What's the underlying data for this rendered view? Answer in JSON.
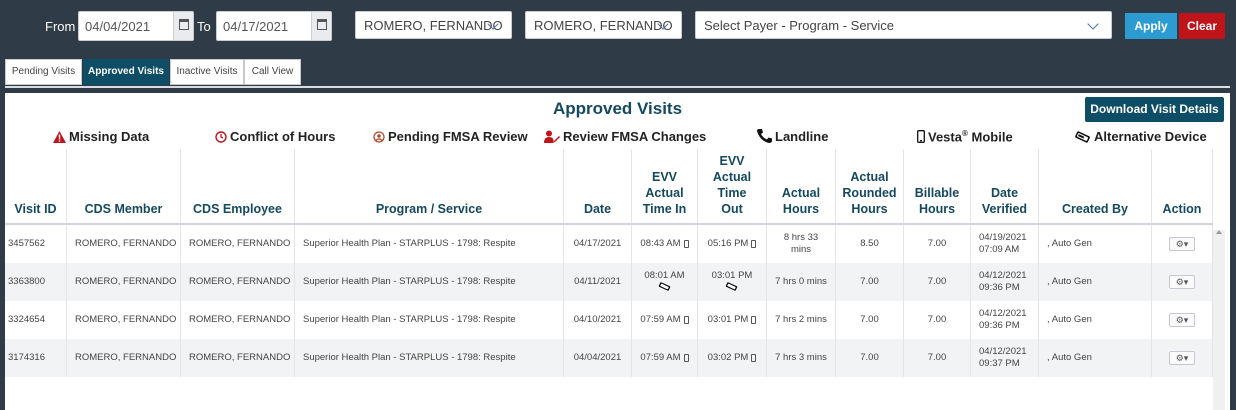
{
  "filter": {
    "from_label": "From",
    "from_date": "04/04/2021",
    "to_label": "To",
    "to_date": "04/17/2021",
    "member_select": "ROMERO, FERNANDO",
    "employee_select": "ROMERO, FERNANDO",
    "payer_placeholder": "Select Payer - Program - Service",
    "apply_label": "Apply",
    "clear_label": "Clear"
  },
  "tabs": [
    {
      "label": "Pending Visits",
      "active": false
    },
    {
      "label": "Approved Visits",
      "active": true
    },
    {
      "label": "Inactive Visits",
      "active": false
    },
    {
      "label": "Call View",
      "active": false
    }
  ],
  "panel": {
    "title": "Approved Visits",
    "download_label": "Download Visit Details"
  },
  "legend": {
    "missing_data": "Missing Data",
    "conflict_hours": "Conflict of Hours",
    "pending_fmsa": "Pending FMSA Review",
    "review_fmsa": "Review FMSA Changes",
    "landline": "Landline",
    "vesta_mobile": "Vesta",
    "vesta_reg": "®",
    "vesta_mobile_suffix": "Mobile",
    "alt_device": "Alternative Device"
  },
  "table": {
    "headers": {
      "visit_id": "Visit ID",
      "cds_member": "CDS Member",
      "cds_employee": "CDS Employee",
      "program_service": "Program / Service",
      "date": "Date",
      "evv_in_1": "EVV",
      "evv_in_2": "Actual",
      "evv_in_3": "Time In",
      "evv_out_1": "EVV",
      "evv_out_2": "Actual",
      "evv_out_3": "Time",
      "evv_out_4": "Out",
      "actual_hours_1": "Actual",
      "actual_hours_2": "Hours",
      "rounded_1": "Actual",
      "rounded_2": "Rounded",
      "rounded_3": "Hours",
      "billable_1": "Billable",
      "billable_2": "Hours",
      "verified_1": "Date",
      "verified_2": "Verified",
      "created_by": "Created By",
      "action": "Action"
    },
    "rows": [
      {
        "visit_id": "3457562",
        "member": "ROMERO, FERNANDO",
        "employee": "ROMERO, FERNANDO",
        "program": "Superior Health Plan - STARPLUS - 1798: Respite",
        "date": "04/17/2021",
        "time_in": "08:43 AM",
        "time_out": "05:16 PM",
        "actual_hours_1": "8 hrs 33",
        "actual_hours_2": "mins",
        "rounded": "8.50",
        "billable": "7.00",
        "verified_date": "04/19/2021",
        "verified_time": "07:09 AM",
        "created_by": ", Auto Gen"
      },
      {
        "visit_id": "3363800",
        "member": "ROMERO, FERNANDO",
        "employee": "ROMERO, FERNANDO",
        "program": "Superior Health Plan - STARPLUS - 1798: Respite",
        "date": "04/11/2021",
        "time_in": "08:01 AM",
        "time_out": "03:01 PM",
        "actual_hours_1": "7 hrs 0 mins",
        "actual_hours_2": "",
        "rounded": "7.00",
        "billable": "7.00",
        "verified_date": "04/12/2021",
        "verified_time": "09:36 PM",
        "created_by": ", Auto Gen"
      },
      {
        "visit_id": "3324654",
        "member": "ROMERO, FERNANDO",
        "employee": "ROMERO, FERNANDO",
        "program": "Superior Health Plan - STARPLUS - 1798: Respite",
        "date": "04/10/2021",
        "time_in": "07:59 AM",
        "time_out": "03:01 PM",
        "actual_hours_1": "7 hrs 2 mins",
        "actual_hours_2": "",
        "rounded": "7.00",
        "billable": "7.00",
        "verified_date": "04/12/2021",
        "verified_time": "09:36 PM",
        "created_by": ", Auto Gen"
      },
      {
        "visit_id": "3174316",
        "member": "ROMERO, FERNANDO",
        "employee": "ROMERO, FERNANDO",
        "program": "Superior Health Plan - STARPLUS - 1798: Respite",
        "date": "04/04/2021",
        "time_in": "07:59 AM",
        "time_out": "03:02 PM",
        "actual_hours_1": "7 hrs 3 mins",
        "actual_hours_2": "",
        "rounded": "7.00",
        "billable": "7.00",
        "verified_date": "04/12/2021",
        "verified_time": "09:37 PM",
        "created_by": ", Auto Gen"
      }
    ]
  },
  "colors": {
    "background": "#2f3b47",
    "brand": "#0e4d66",
    "apply": "#2b9bd1",
    "clear": "#c0141b",
    "warning": "#c0141b"
  },
  "icons": [
    "calendar-icon",
    "chevron-down-icon",
    "warning-icon",
    "clock-icon",
    "user-circle-icon",
    "user-edit-icon",
    "phone-icon",
    "mobile-icon",
    "tag-icon",
    "gear-icon"
  ]
}
